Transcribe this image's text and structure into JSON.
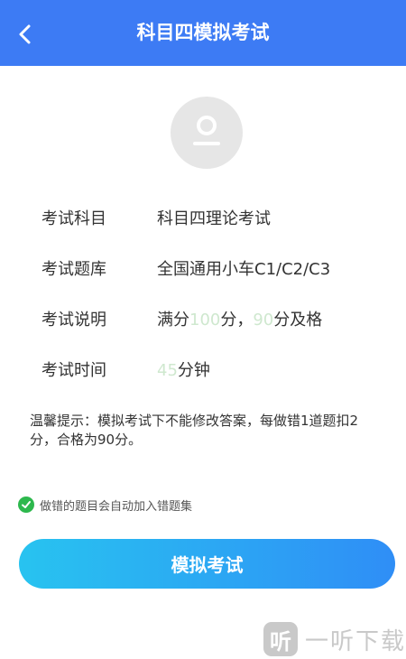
{
  "header": {
    "title": "科目四模拟考试",
    "back_icon": "chevron-left-icon"
  },
  "avatar": {
    "icon": "user-avatar-icon"
  },
  "info": {
    "subject": {
      "label": "考试科目",
      "value": "科目四理论考试"
    },
    "bank": {
      "label": "考试题库",
      "value": "全国通用小车C1/C2/C3"
    },
    "rules": {
      "label": "考试说明",
      "prefix": "满分",
      "full_score": "100",
      "middle": "分，",
      "pass_score": "90",
      "suffix": "分及格"
    },
    "time": {
      "label": "考试时间",
      "minutes": "45",
      "unit": "分钟"
    }
  },
  "tip": "温馨提示：模拟考试下不能修改答案，每做错1道题扣2分，合格为90分。",
  "notice": {
    "icon": "check-circle-icon",
    "text": "做错的题目会自动加入错题集"
  },
  "start_button": "模拟考试",
  "watermark": {
    "logo": "听",
    "text": "一听下载"
  },
  "colors": {
    "header_bg": "#3d7bf4",
    "button_start": "#28c3f0",
    "button_end": "#2f8ef6",
    "check_green": "#2db84d",
    "light_number": "#cfe8cf"
  }
}
